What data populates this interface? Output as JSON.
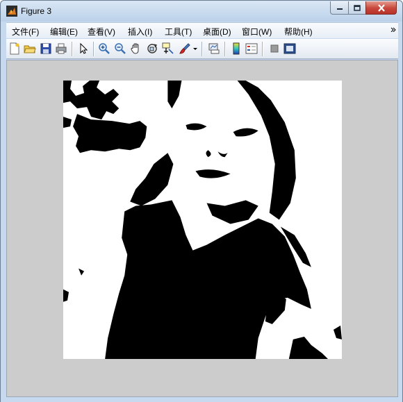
{
  "window": {
    "title": "Figure 3",
    "controls": {
      "minimize_icon": "minimize-icon",
      "maximize_icon": "maximize-icon",
      "close_icon": "close-icon"
    }
  },
  "menubar": {
    "items": [
      {
        "label": "文件(F)"
      },
      {
        "label": "编辑(E)"
      },
      {
        "label": "查看(V)"
      },
      {
        "label": "插入(I)"
      },
      {
        "label": "工具(T)"
      },
      {
        "label": "桌面(D)"
      },
      {
        "label": "窗口(W)"
      },
      {
        "label": "帮助(H)"
      }
    ],
    "overflow_icon": "chevron-icon"
  },
  "toolbar": {
    "icons": [
      "new-figure-icon",
      "open-file-icon",
      "save-icon",
      "print-icon",
      "edit-plot-arrow-icon",
      "zoom-in-icon",
      "zoom-out-icon",
      "pan-hand-icon",
      "rotate-3d-icon",
      "data-cursor-icon",
      "brush-icon",
      "dropdown-arrow-icon",
      "link-plot-icon",
      "insert-colorbar-icon",
      "insert-legend-icon",
      "hide-plot-tools-icon",
      "show-plot-tools-icon"
    ]
  },
  "figure": {
    "background_color": "#cccccc",
    "image_description_colors": {
      "foreground": "#000000",
      "background": "#ffffff"
    }
  },
  "colors": {
    "titlebar": "#c6d9ee",
    "close_button": "#c7463a",
    "menubar": "#f0f4f9",
    "figure_background": "#cccccc"
  }
}
